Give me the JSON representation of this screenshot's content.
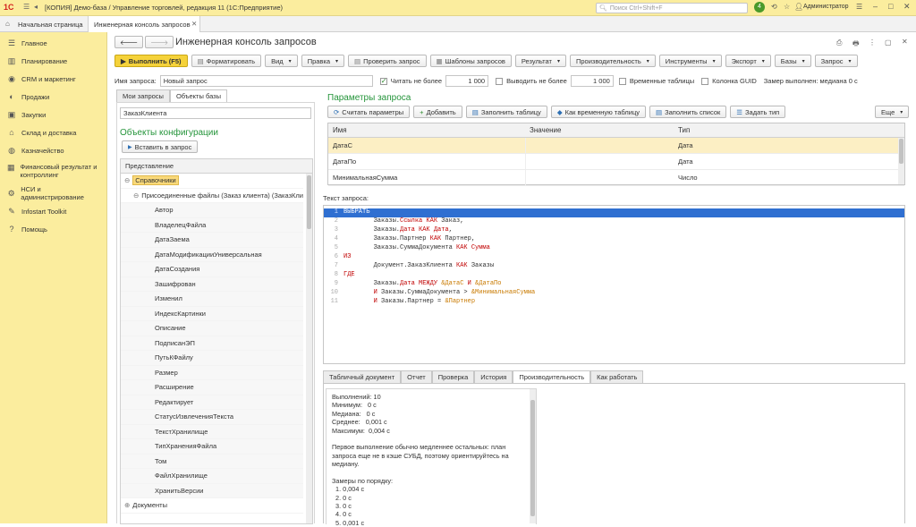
{
  "titlebar": {
    "logo": "1С",
    "title": "[КОПИЯ] Демо-база / Управление торговлей, редакция 11  (1С:Предприятие)",
    "search_placeholder": "Поиск Ctrl+Shift+F",
    "notification_count": "4",
    "user": "Администратор"
  },
  "tabs": {
    "home_label": "Начальная страница",
    "active_label": "Инженерная консоль запросов"
  },
  "sidebar": {
    "items": [
      {
        "icon": "menu-icon",
        "label": "Главное"
      },
      {
        "icon": "chart-icon",
        "label": "Планирование"
      },
      {
        "icon": "crm-icon",
        "label": "CRM и маркетинг"
      },
      {
        "icon": "sales-icon",
        "label": "Продажи"
      },
      {
        "icon": "cart-icon",
        "label": "Закупки"
      },
      {
        "icon": "warehouse-icon",
        "label": "Склад и доставка"
      },
      {
        "icon": "treasury-icon",
        "label": "Казначейство"
      },
      {
        "icon": "finance-icon",
        "label": "Финансовый результат и контроллинг"
      },
      {
        "icon": "settings-icon",
        "label": "НСИ и администрирование"
      },
      {
        "icon": "toolkit-icon",
        "label": "Infostart Toolkit"
      },
      {
        "icon": "help-icon",
        "label": "Помощь"
      }
    ]
  },
  "form": {
    "title": "Инженерная консоль запросов",
    "toolbar": {
      "run": "Выполнить (F5)",
      "format": "Форматировать",
      "view": "Вид",
      "edit": "Правка",
      "check": "Проверить запрос",
      "templates": "Шаблоны запросов",
      "result": "Результат",
      "performance": "Производительность",
      "tools": "Инструменты",
      "export": "Экспорт",
      "bases": "Базы",
      "query": "Запрос"
    },
    "options": {
      "name_label": "Имя запроса:",
      "name_value": "Новый запрос",
      "read_limit_label": "Читать не более",
      "read_limit_value": "1 000",
      "output_limit_label": "Выводить не более",
      "output_limit_value": "1 000",
      "temp_tables_label": "Временные таблицы",
      "guid_label": "Колонка GUID",
      "measure_text": "Замер выполнен: медиана 0 с"
    }
  },
  "left_panel": {
    "tabs": [
      "Мои запросы",
      "Объекты базы"
    ],
    "search_value": "ЗаказКлиента",
    "config_title": "Объекты конфигурации",
    "insert_button": "Вставить в запрос",
    "tree_header": "Представление",
    "tree": [
      {
        "text": "Справочники",
        "level": 0,
        "expander": "⊖",
        "selected": true
      },
      {
        "text": "Присоединенные файлы (Заказ клиента) (ЗаказКлие",
        "level": 1,
        "expander": "⊖"
      },
      {
        "text": "Автор",
        "level": 2
      },
      {
        "text": "ВладелецФайла",
        "level": 2
      },
      {
        "text": "ДатаЗаема",
        "level": 2
      },
      {
        "text": "ДатаМодификацииУниверсальная",
        "level": 2
      },
      {
        "text": "ДатаСоздания",
        "level": 2
      },
      {
        "text": "Зашифрован",
        "level": 2
      },
      {
        "text": "Изменил",
        "level": 2
      },
      {
        "text": "ИндексКартинки",
        "level": 2
      },
      {
        "text": "Описание",
        "level": 2
      },
      {
        "text": "ПодписанЭП",
        "level": 2
      },
      {
        "text": "ПутьКФайлу",
        "level": 2
      },
      {
        "text": "Размер",
        "level": 2
      },
      {
        "text": "Расширение",
        "level": 2
      },
      {
        "text": "Редактирует",
        "level": 2
      },
      {
        "text": "СтатусИзвлеченияТекста",
        "level": 2
      },
      {
        "text": "ТекстХранилище",
        "level": 2
      },
      {
        "text": "ТипХраненияФайла",
        "level": 2
      },
      {
        "text": "Том",
        "level": 2
      },
      {
        "text": "ФайлХранилище",
        "level": 2
      },
      {
        "text": "ХранитьВерсии",
        "level": 2
      },
      {
        "text": "Документы",
        "level": 0,
        "expander": "⊕"
      }
    ]
  },
  "params": {
    "title": "Параметры запроса",
    "buttons": [
      "Считать параметры",
      "Добавить",
      "Заполнить таблицу",
      "Как временную таблицу",
      "Заполнить список",
      "Задать тип"
    ],
    "more": "Еще",
    "columns": [
      "Имя",
      "Значение",
      "Тип"
    ],
    "rows": [
      {
        "name": "ДатаС",
        "value": "",
        "type": "Дата"
      },
      {
        "name": "ДатаПо",
        "value": "",
        "type": "Дата"
      },
      {
        "name": "МинимальнаяСумма",
        "value": "",
        "type": "Число"
      }
    ]
  },
  "editor": {
    "label": "Текст запроса:",
    "lines": [
      {
        "n": "1",
        "tokens": [
          {
            "t": "ВЫБРАТЬ",
            "c": "sel"
          }
        ]
      },
      {
        "n": "2",
        "tokens": [
          {
            "t": "        Заказы.",
            "c": ""
          },
          {
            "t": "Ссылка КАК",
            "c": "kw"
          },
          {
            "t": " Заказ,",
            "c": ""
          }
        ]
      },
      {
        "n": "3",
        "tokens": [
          {
            "t": "        Заказы.",
            "c": ""
          },
          {
            "t": "Дата КАК Дата",
            "c": "kw"
          },
          {
            "t": ",",
            "c": ""
          }
        ]
      },
      {
        "n": "4",
        "tokens": [
          {
            "t": "        Заказы.Партнер ",
            "c": ""
          },
          {
            "t": "КАК",
            "c": "kw"
          },
          {
            "t": " Партнер,",
            "c": ""
          }
        ]
      },
      {
        "n": "5",
        "tokens": [
          {
            "t": "        Заказы.СуммаДокумента ",
            "c": ""
          },
          {
            "t": "КАК Сумма",
            "c": "kw"
          }
        ]
      },
      {
        "n": "6",
        "tokens": [
          {
            "t": "ИЗ",
            "c": "kw"
          }
        ]
      },
      {
        "n": "7",
        "tokens": [
          {
            "t": "        Документ.ЗаказКлиента ",
            "c": ""
          },
          {
            "t": "КАК",
            "c": "kw"
          },
          {
            "t": " Заказы",
            "c": ""
          }
        ]
      },
      {
        "n": "8",
        "tokens": [
          {
            "t": "ГДЕ",
            "c": "kw"
          }
        ]
      },
      {
        "n": "9",
        "tokens": [
          {
            "t": "        Заказы.",
            "c": ""
          },
          {
            "t": "Дата МЕЖДУ",
            "c": "kw"
          },
          {
            "t": " &ДатаС ",
            "c": "par"
          },
          {
            "t": "И",
            "c": "kw"
          },
          {
            "t": " &ДатаПо",
            "c": "par"
          }
        ]
      },
      {
        "n": "10",
        "tokens": [
          {
            "t": "        ",
            "c": ""
          },
          {
            "t": "И",
            "c": "kw"
          },
          {
            "t": " Заказы.СуммаДокумента > ",
            "c": ""
          },
          {
            "t": "&МинимальнаяСумма",
            "c": "par"
          }
        ]
      },
      {
        "n": "11",
        "tokens": [
          {
            "t": "        ",
            "c": ""
          },
          {
            "t": "И",
            "c": "kw"
          },
          {
            "t": " Заказы.Партнер = ",
            "c": ""
          },
          {
            "t": "&Партнер",
            "c": "par"
          }
        ]
      }
    ]
  },
  "bottom": {
    "tabs": [
      "Табличный документ",
      "Отчет",
      "Проверка",
      "История",
      "Производительность",
      "Как работать"
    ],
    "active_tab": 4,
    "report_lines": [
      "Выполнений: 10",
      "Минимум:   0 с",
      "Медиана:   0 с",
      "Среднее:   0,001 с",
      "Максимум:  0,004 с",
      "",
      "Первое выполнение обычно медленнее остальных: план",
      "запроса еще не в кэше СУБД, поэтому ориентируйтесь на",
      "медиану.",
      "",
      "Замеры по порядку:",
      "  1. 0,004 с",
      "  2. 0 с",
      "  3. 0 с",
      "  4. 0 с",
      "  5. 0,001 с"
    ]
  },
  "colors": {
    "accent_yellow": "#fbed9e",
    "run_button": "#f5d23a",
    "section_green": "#24943a",
    "keyword_red": "#c00000",
    "param_orange": "#c97a00",
    "selected_row": "#fcefc4"
  }
}
